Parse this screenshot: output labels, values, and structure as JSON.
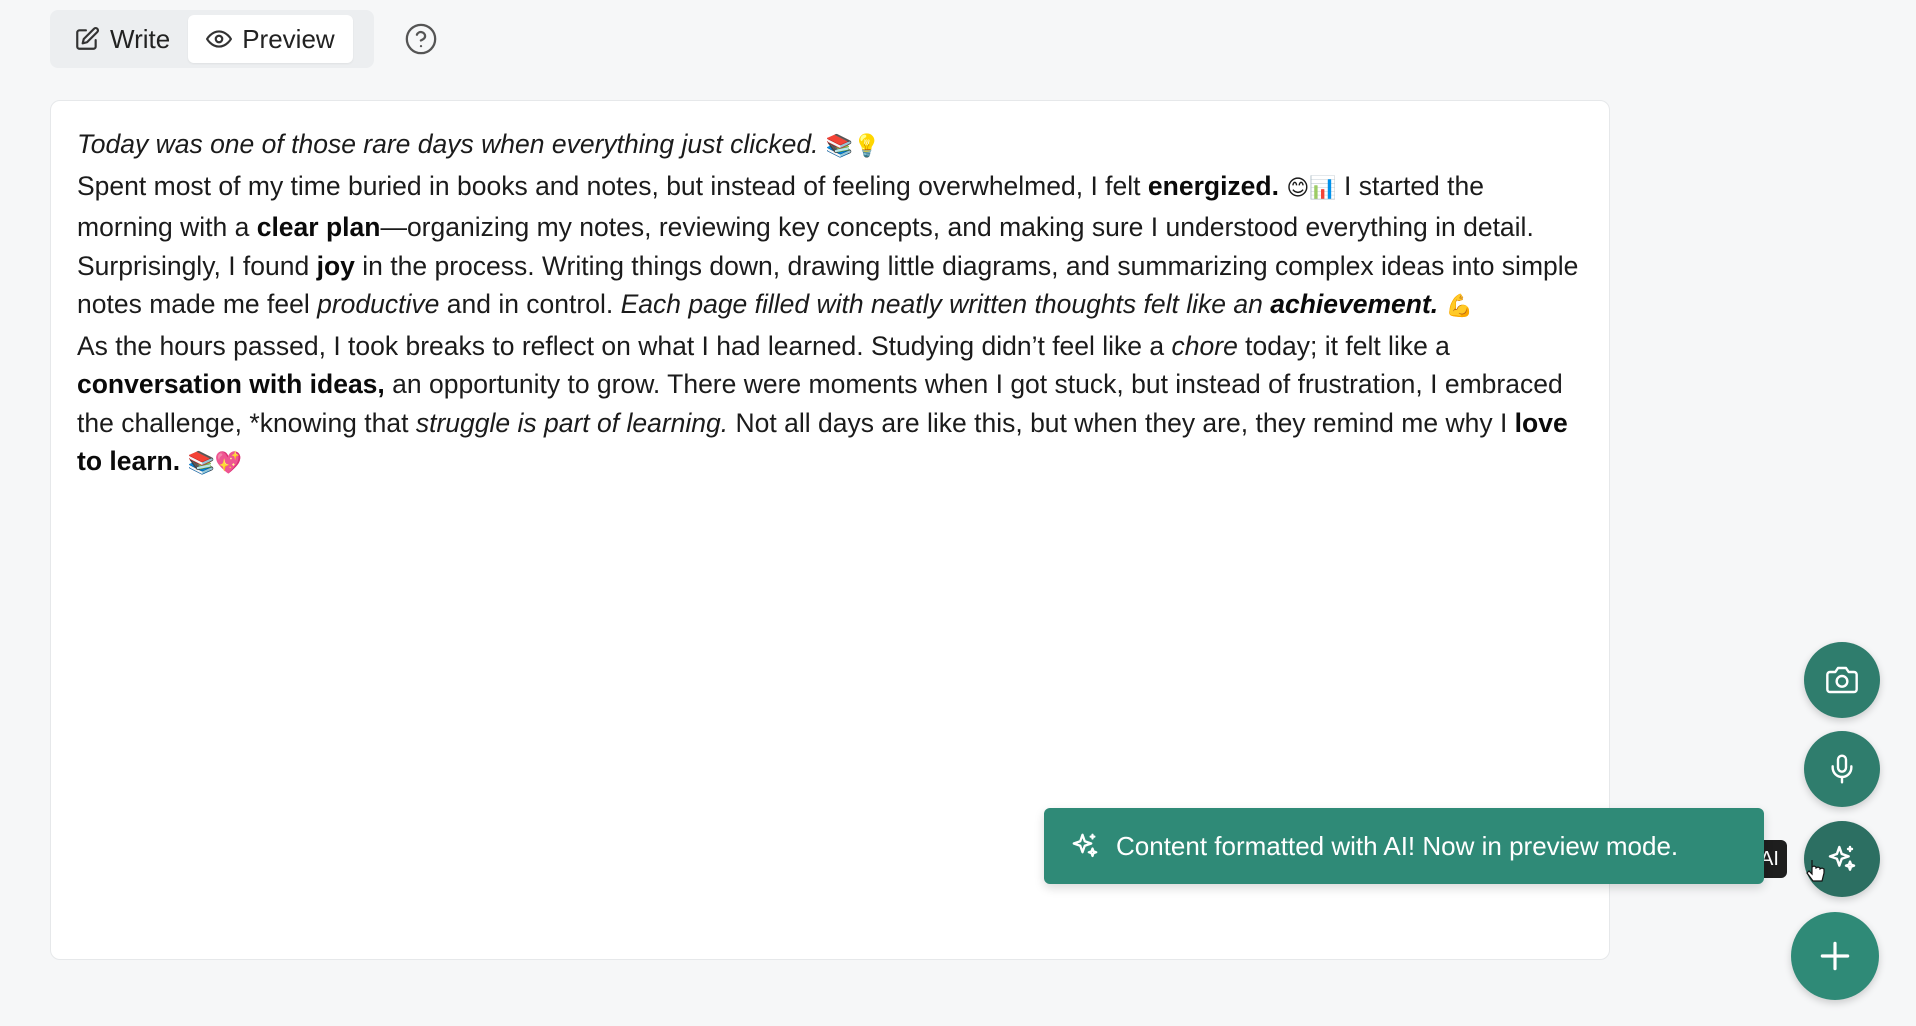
{
  "toolbar": {
    "write_label": "Write",
    "preview_label": "Preview"
  },
  "editor": {
    "p1": {
      "italic": "Today was one of those rare days when everything just clicked.",
      "emoji": "📚💡"
    },
    "p2": {
      "t1": "Spent most of my time buried in books and notes, but instead of feeling overwhelmed, I felt ",
      "b1": "energized.",
      "emoji1": "😊📊",
      "t2": " I started the morning with a ",
      "b2": "clear plan",
      "t3": "—organizing my notes, reviewing key concepts, and making sure I understood everything in detail. Surprisingly, I found ",
      "b3": "joy",
      "t4": " in the process. Writing things down, drawing little diagrams, and summarizing complex ideas into simple notes made me feel ",
      "i1": "productive",
      "t5": " and in control. ",
      "i2": "Each page filled with neatly written thoughts felt like an ",
      "bi1": "achievement.",
      "emoji2": "💪"
    },
    "p3": {
      "t1": "As the hours passed, I took breaks to reflect on what I had learned. Studying didn’t feel like a ",
      "i1": "chore",
      "t2": " today; it felt like a ",
      "b1": "conversation with ideas,",
      "t3": " an opportunity to grow. There were moments when I got stuck, but instead of frustration, I embraced the challenge, *knowing that ",
      "i2": "struggle is part of learning.",
      "t4": " Not all days are like this, but when they are, they remind me why I ",
      "b2": "love to learn.",
      "emoji": "📚💖"
    }
  },
  "fab": {
    "tooltip": "AI"
  },
  "toast": {
    "message": "Content formatted with AI! Now in preview mode."
  },
  "colors": {
    "accent": "#2f8a77",
    "accent_dark": "#2c6f62",
    "background": "#f6f7f8"
  },
  "icons": [
    "edit-icon",
    "eye-icon",
    "help-icon",
    "camera-icon",
    "mic-icon",
    "sparkles-icon",
    "plus-icon"
  ]
}
